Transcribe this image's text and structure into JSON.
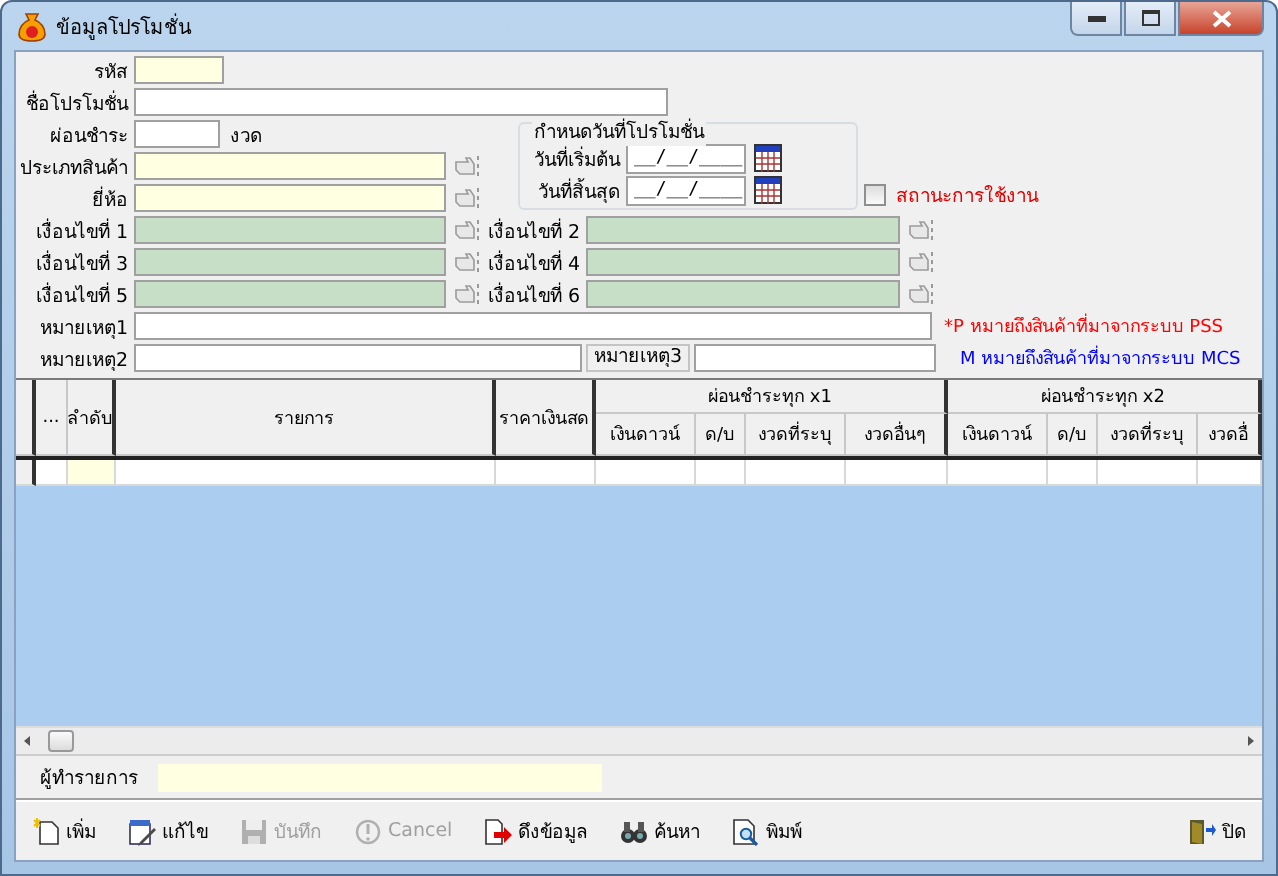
{
  "window": {
    "title": "ข้อมูลโปรโมชั่น"
  },
  "form": {
    "code": {
      "label": "รหัส",
      "kind": "key"
    },
    "name": {
      "label": "ชื่อโปรโมชั่น"
    },
    "installments": {
      "label": "ผ่อนชำระ",
      "unit": "งวด"
    },
    "product_type": {
      "label": "ประเภทสินค้า",
      "kind": "lookup"
    },
    "brand": {
      "label": "ยี่ห้อ",
      "kind": "lookup"
    },
    "date_group": {
      "title": "กำหนดวันที่โปรโมชั่น",
      "start": {
        "label": "วันที่เริ่มต้น",
        "value": "__/__/____"
      },
      "end": {
        "label": "วันที่สิ้นสุด",
        "value": "__/__/____"
      }
    },
    "active": {
      "label": "สถานะการใช้งาน",
      "checked": false
    },
    "conditions": [
      {
        "label": "เงื่อนไขที่ 1",
        "kind": "condition"
      },
      {
        "label": "เงื่อนไขที่ 2",
        "kind": "condition"
      },
      {
        "label": "เงื่อนไขที่ 3",
        "kind": "condition"
      },
      {
        "label": "เงื่อนไขที่ 4",
        "kind": "condition"
      },
      {
        "label": "เงื่อนไขที่ 5",
        "kind": "condition"
      },
      {
        "label": "เงื่อนไขที่ 6",
        "kind": "condition"
      }
    ],
    "notes": [
      {
        "label": "หมายเหตุ1"
      },
      {
        "label": "หมายเหตุ2"
      },
      {
        "label": "หมายเหตุ3"
      }
    ],
    "legend": [
      {
        "text": "*P  หมายถึงสินค้าที่มาจากระบบ PSS",
        "color": "#ff0000"
      },
      {
        "text": "M  หมายถึงสินค้าที่มาจากระบบ MCS",
        "color": "#0000ff"
      }
    ]
  },
  "table": {
    "columns": [
      {
        "label": "..."
      },
      {
        "label": "ลำดับ"
      },
      {
        "label": "รายการ"
      },
      {
        "label": "ราคาเงินสด"
      },
      {
        "label": "ผ่อนชำระทุก x1",
        "children": [
          {
            "label": "เงินดาวน์"
          },
          {
            "label": "ด/บ"
          },
          {
            "label": "งวดที่ระบุ"
          },
          {
            "label": "งวดอื่นๆ"
          }
        ]
      },
      {
        "label": "ผ่อนชำระทุก x2",
        "children": [
          {
            "label": "เงินดาวน์"
          },
          {
            "label": "ด/บ"
          },
          {
            "label": "งวดที่ระบุ"
          },
          {
            "label": "งวดอื่"
          }
        ]
      }
    ]
  },
  "operator": {
    "label": "ผู้ทำรายการ"
  },
  "toolbar": {
    "left": [
      {
        "label": "เพิ่ม",
        "disabled": false
      },
      {
        "label": "แก้ไข",
        "disabled": false
      },
      {
        "label": "บันทึก",
        "disabled": true
      },
      {
        "label": "Cancel",
        "disabled": true
      },
      {
        "label": "ดึงข้อมูล",
        "disabled": false
      },
      {
        "label": "ค้นหา",
        "disabled": false
      },
      {
        "label": "พิมพ์",
        "disabled": false
      }
    ],
    "right": [
      {
        "label": "ปิด",
        "disabled": false
      }
    ]
  }
}
